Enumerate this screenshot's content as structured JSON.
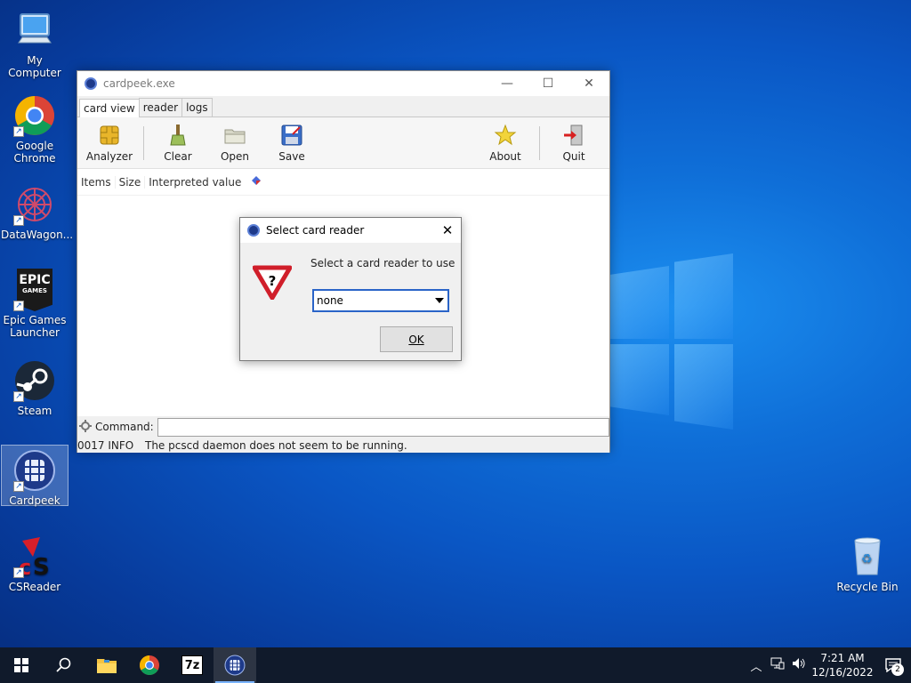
{
  "desktop": {
    "icons": [
      {
        "label": "My Computer"
      },
      {
        "label": "Google Chrome"
      },
      {
        "label": "DataWagon..."
      },
      {
        "label": "Epic Games Launcher"
      },
      {
        "label": "Steam"
      },
      {
        "label": "Cardpeek"
      },
      {
        "label": "CSReader"
      },
      {
        "label": "Recycle Bin"
      }
    ],
    "epic_logo_text": "EPIC",
    "epic_logo_sub": "GAMES"
  },
  "window": {
    "title": "cardpeek.exe",
    "tabs": [
      "card view",
      "reader",
      "logs"
    ],
    "toolbar": {
      "analyzer": "Analyzer",
      "clear": "Clear",
      "open": "Open",
      "save": "Save",
      "about": "About",
      "quit": "Quit"
    },
    "columns": [
      "Items",
      "Size",
      "Interpreted value"
    ],
    "command_label": "Command:",
    "command_value": "",
    "status_code": "0017 INFO",
    "status_message": "The pcscd daemon does not seem to be running."
  },
  "dialog": {
    "title": "Select card reader",
    "message": "Select a card reader to use",
    "selected_reader": "none",
    "ok_label": "OK",
    "icon_glyph": "?"
  },
  "taskbar": {
    "time": "7:21 AM",
    "date": "12/16/2022",
    "notification_count": "2",
    "sevenzip_label": "7z"
  },
  "colors": {
    "accent": "#2a64c8",
    "taskbar": "#101a2b"
  }
}
